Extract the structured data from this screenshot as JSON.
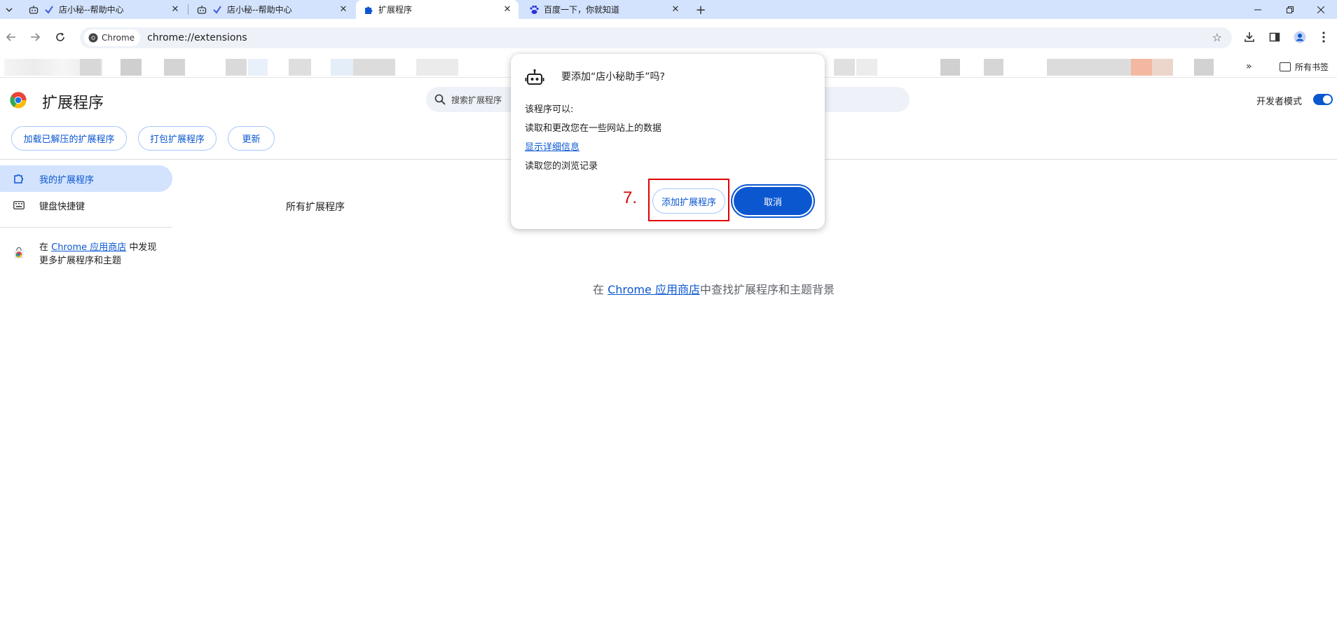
{
  "tabs": [
    {
      "label": "店小秘--帮助中心",
      "active": false
    },
    {
      "label": "店小秘--帮助中心",
      "active": false
    },
    {
      "label": "扩展程序",
      "active": true
    },
    {
      "label": "百度一下，你就知道",
      "active": false
    }
  ],
  "toolbar": {
    "chip_label": "Chrome",
    "url": "chrome://extensions"
  },
  "bookmarks": {
    "all_bookmarks_label": "所有书签"
  },
  "extensions_page": {
    "title": "扩展程序",
    "search_placeholder": "搜索扩展程序",
    "dev_mode_label": "开发者模式",
    "dev_mode_on": true,
    "actions": {
      "load_unpacked": "加载已解压的扩展程序",
      "pack": "打包扩展程序",
      "update": "更新"
    },
    "sidebar": {
      "my_extensions": "我的扩展程序",
      "keyboard_shortcuts": "键盘快捷键",
      "store_prefix": "在 ",
      "store_link": "Chrome 应用商店",
      "store_suffix": " 中发现",
      "store_line2": "更多扩展程序和主题"
    },
    "all_extensions_heading": "所有扩展程序",
    "empty": {
      "prefix": "在 ",
      "link": "Chrome 应用商店",
      "suffix": "中查找扩展程序和主题背景"
    }
  },
  "dialog": {
    "title": "要添加“店小秘助手”吗?",
    "permissions_heading": "该程序可以:",
    "permission_1": "读取和更改您在一些网站上的数据",
    "show_details": "显示详细信息",
    "permission_2": "读取您的浏览记录",
    "add_button": "添加扩展程序",
    "cancel_button": "取消",
    "step_annotation": "7."
  },
  "colors": {
    "accent": "#0b57d0",
    "tabstrip": "#d3e3fd",
    "annotation_red": "#e00000"
  }
}
